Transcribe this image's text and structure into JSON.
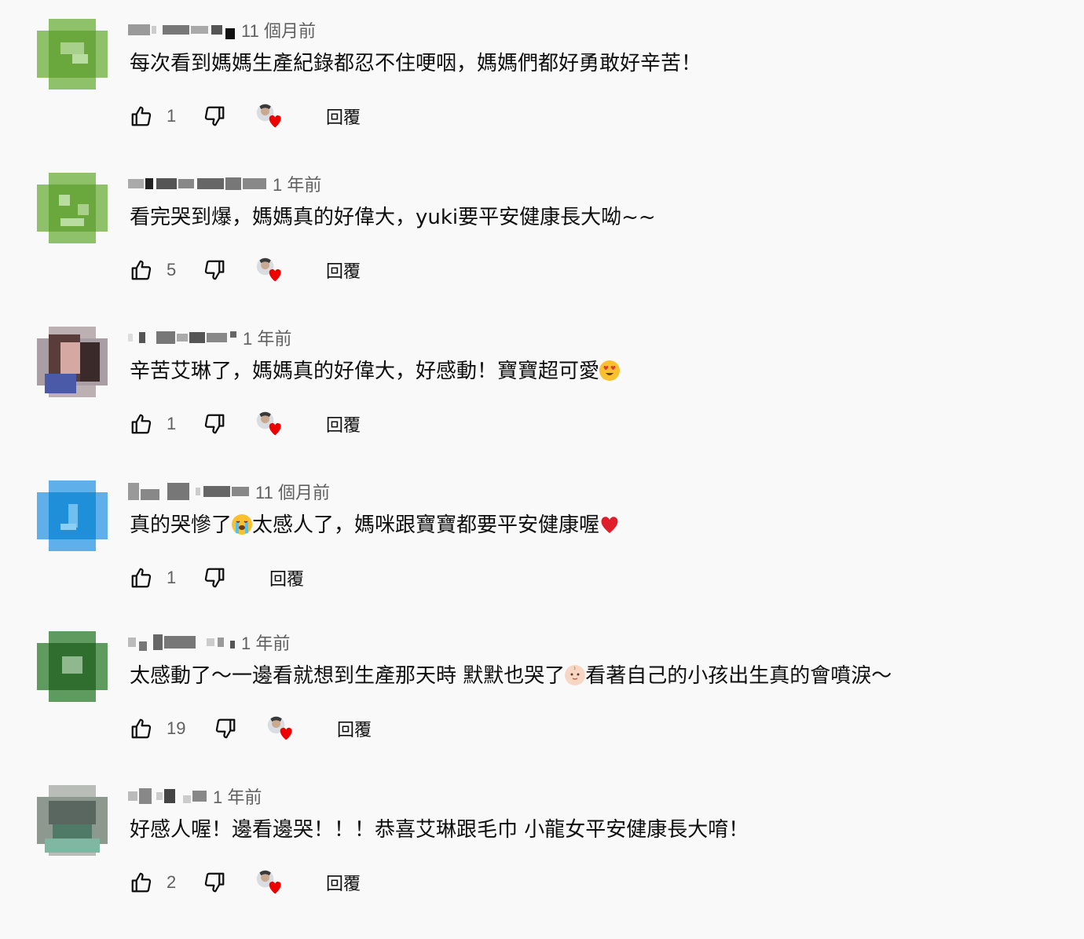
{
  "reply_label": "回覆",
  "comments": [
    {
      "author_censored": true,
      "time": "11 個月前",
      "text": "每次看到媽媽生產紀錄都忍不住哽咽，媽媽們都好勇敢好辛苦！",
      "likes": "1",
      "creator_hearted": true,
      "avatar_color": "#74b04a"
    },
    {
      "author_censored": true,
      "time": "1 年前",
      "text": "看完哭到爆，媽媽真的好偉大，yuki要平安健康長大呦~~",
      "likes": "5",
      "creator_hearted": true,
      "avatar_color": "#74b04a"
    },
    {
      "author_censored": true,
      "time": "1 年前",
      "text": "辛苦艾琳了，媽媽真的好偉大，好感動！寶寶超可愛",
      "emoji_after": "heart-eyes-emoji",
      "likes": "1",
      "creator_hearted": true,
      "avatar_color": "#8a6b63"
    },
    {
      "author_censored": true,
      "time": "11 個月前",
      "text_parts": [
        "真的哭慘了",
        "太感人了，媽咪跟寶寶都要平安健康喔"
      ],
      "emoji_mid": "loudly-crying-emoji",
      "emoji_after": "red-heart-emoji",
      "likes": "1",
      "creator_hearted": false,
      "avatar_color": "#1e8fd8"
    },
    {
      "author_censored": true,
      "time": "1 年前",
      "text_parts": [
        "太感動了～一邊看就想到生產那天時 默默也哭了",
        "看著自己的小孩出生真的會噴淚～"
      ],
      "emoji_mid": "baby-emoji",
      "likes": "19",
      "creator_hearted": true,
      "avatar_color": "#3a7a3a"
    },
    {
      "author_censored": true,
      "time": "1 年前",
      "text": "好感人喔！邊看邊哭！！！恭喜艾琳跟毛巾  小龍女平安健康長大唷！",
      "likes": "2",
      "creator_hearted": true,
      "avatar_color": "#6f8a78"
    }
  ]
}
